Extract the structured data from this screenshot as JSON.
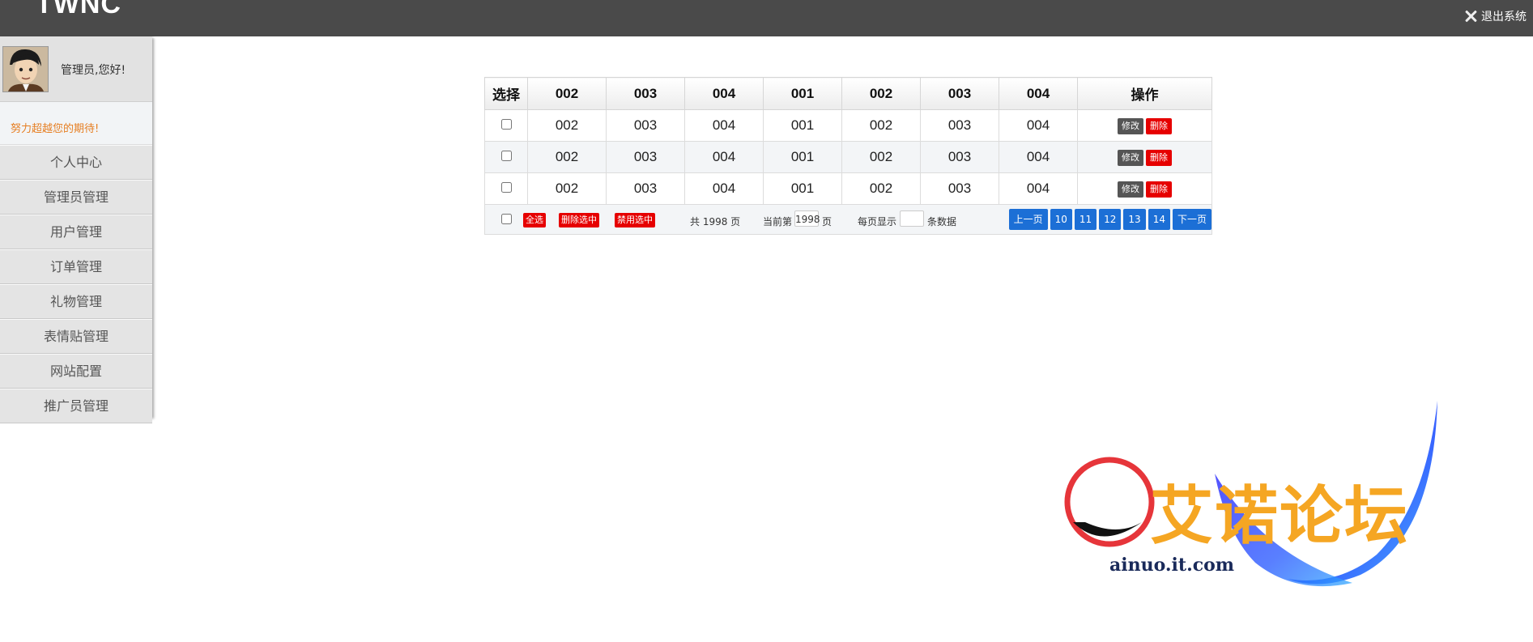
{
  "header": {
    "brand": "TWNC",
    "logout_label": "退出系统"
  },
  "sidebar": {
    "greeting": "管理员,您好!",
    "motto": "努力超越您的期待!",
    "items": [
      {
        "label": "个人中心"
      },
      {
        "label": "管理员管理"
      },
      {
        "label": "用户管理"
      },
      {
        "label": "订单管理"
      },
      {
        "label": "礼物管理"
      },
      {
        "label": "表情贴管理"
      },
      {
        "label": "网站配置"
      },
      {
        "label": "推广员管理"
      }
    ]
  },
  "table": {
    "headers": [
      "选择",
      "002",
      "003",
      "004",
      "001",
      "002",
      "003",
      "004",
      "操作"
    ],
    "rows": [
      [
        "002",
        "003",
        "004",
        "001",
        "002",
        "003",
        "004"
      ],
      [
        "002",
        "003",
        "004",
        "001",
        "002",
        "003",
        "004"
      ],
      [
        "002",
        "003",
        "004",
        "001",
        "002",
        "003",
        "004"
      ]
    ],
    "edit_label": "修改",
    "delete_label": "删除"
  },
  "footer": {
    "select_all": "全选",
    "delete_selected": "删除选中",
    "disable_selected": "禁用选中",
    "total_pages": "共 1998 页",
    "current_prefix": "当前第",
    "current_page": "1998",
    "current_suffix": "页",
    "per_page_prefix": "每页显示",
    "per_page_suffix": "条数据",
    "pager": {
      "prev": "上一页",
      "pages": [
        "10",
        "11",
        "12",
        "13",
        "14"
      ],
      "next": "下一页"
    }
  },
  "watermark": {
    "text": "艾诺论坛",
    "url": "ainuo.it.com"
  }
}
